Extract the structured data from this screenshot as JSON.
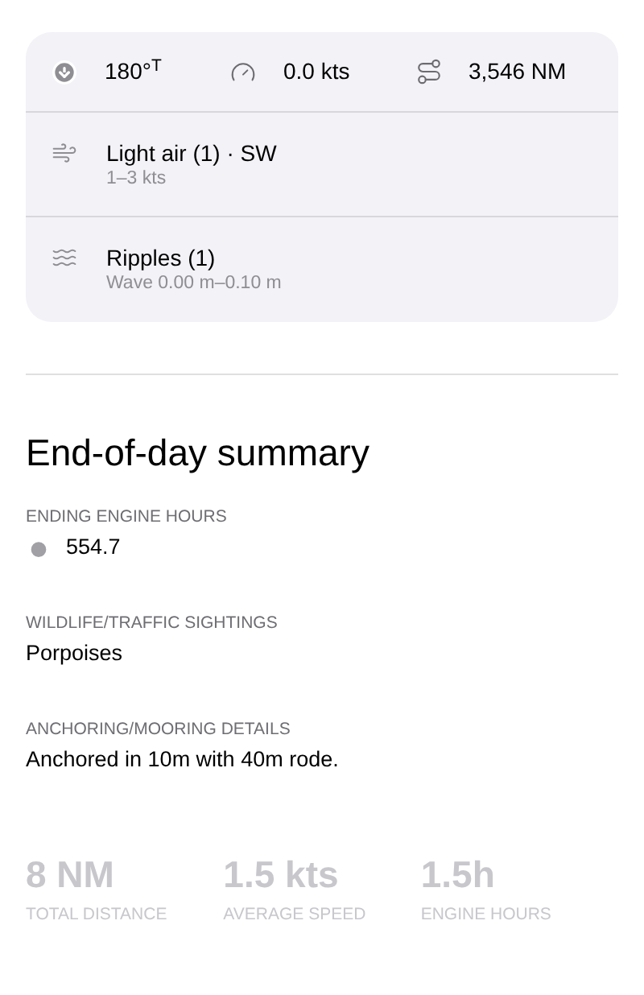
{
  "conditions": {
    "metrics": [
      {
        "kind": "heading",
        "value": "180°$^{T}$"
      },
      {
        "kind": "speed",
        "value": "0.0 kts"
      },
      {
        "kind": "distance",
        "value": "3,546 NM"
      }
    ],
    "rows": [
      {
        "kind": "wind",
        "title": "Light air (1) · SW",
        "subtitle": "1–3 kts"
      },
      {
        "kind": "waves",
        "title": "Ripples (1)",
        "subtitle": "Wave 0.00 m–0.10 m"
      }
    ]
  },
  "summary": {
    "title": "End-of-day summary",
    "fields": [
      {
        "kind": "engine",
        "label": "ENDING ENGINE HOURS",
        "value": "554.7"
      },
      {
        "kind": "text",
        "label": "WILDLIFE/TRAFFIC SIGHTINGS",
        "value": "Porpoises"
      },
      {
        "kind": "text",
        "label": "ANCHORING/MOORING DETAILS",
        "value": "Anchored in 10m with 40m rode."
      }
    ],
    "stats": [
      {
        "value": "8 NM",
        "label": "TOTAL DISTANCE"
      },
      {
        "value": "1.5 kts",
        "label": "AVERAGE SPEED"
      },
      {
        "value": "1.5h",
        "label": "ENGINE HOURS"
      }
    ]
  }
}
